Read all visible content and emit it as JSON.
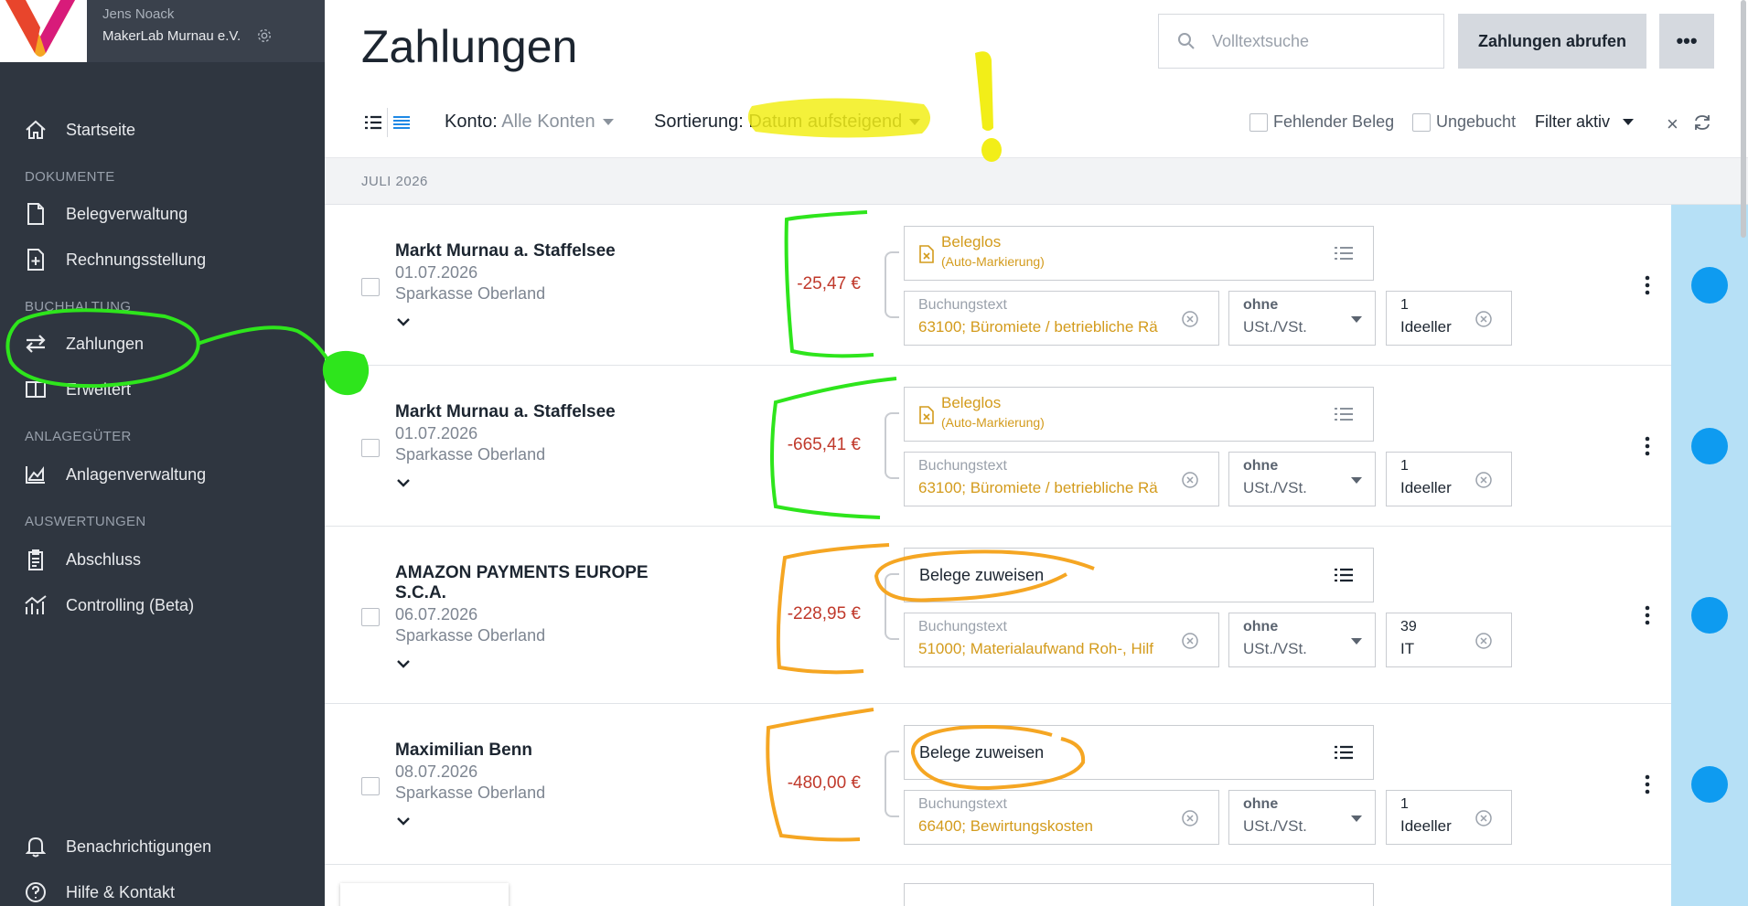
{
  "account": {
    "user": "Jens Noack",
    "org": "MakerLab Murnau e.V."
  },
  "sidebar": {
    "items": [
      {
        "label": "Startseite"
      },
      {
        "section": "DOKUMENTE"
      },
      {
        "label": "Belegverwaltung"
      },
      {
        "label": "Rechnungsstellung"
      },
      {
        "section": "BUCHHALTUNG"
      },
      {
        "label": "Zahlungen"
      },
      {
        "label": "Erweitert"
      },
      {
        "section": "ANLAGEGÜTER"
      },
      {
        "label": "Anlagenverwaltung"
      },
      {
        "section": "AUSWERTUNGEN"
      },
      {
        "label": "Abschluss"
      },
      {
        "label": "Controlling (Beta)"
      }
    ],
    "footer": [
      {
        "label": "Benachrichtigungen"
      },
      {
        "label": "Hilfe & Kontakt"
      }
    ]
  },
  "header": {
    "title": "Zahlungen",
    "search_placeholder": "Volltextsuche",
    "fetch_label": "Zahlungen abrufen",
    "more_label": "•••"
  },
  "toolbar": {
    "account_label": "Konto:",
    "account_value": "Alle Konten",
    "sort_label": "Sortierung:",
    "sort_value": "Datum aufsteigend",
    "missing_receipt": "Fehlender Beleg",
    "unbooked": "Ungebucht",
    "filter": "Filter aktiv",
    "clear": "×"
  },
  "month": "JULI 2026",
  "payments": [
    {
      "payee": "Markt Murnau a. Staffelsee",
      "date": "01.07.2026",
      "bank": "Sparkasse Oberland",
      "amount": "-25,47 €",
      "doc_title": "Beleglos",
      "doc_sub": "(Auto-Markierung)",
      "text_label": "Buchungstext",
      "text_value": "63100; Büromiete / betriebliche Rä",
      "tax_label": "ohne",
      "tax_value": "USt./VSt.",
      "cost_label": "1",
      "cost_value": "Ideeller"
    },
    {
      "payee": "Markt Murnau a. Staffelsee",
      "date": "01.07.2026",
      "bank": "Sparkasse Oberland",
      "amount": "-665,41 €",
      "doc_title": "Beleglos",
      "doc_sub": "(Auto-Markierung)",
      "text_label": "Buchungstext",
      "text_value": "63100; Büromiete / betriebliche Rä",
      "tax_label": "ohne",
      "tax_value": "USt./VSt.",
      "cost_label": "1",
      "cost_value": "Ideeller"
    },
    {
      "payee": "AMAZON PAYMENTS EUROPE S.C.A.",
      "date": "06.07.2026",
      "bank": "Sparkasse Oberland",
      "amount": "-228,95 €",
      "doc_title": "Belege zuweisen",
      "text_label": "Buchungstext",
      "text_value": "51000; Materialaufwand Roh-, Hilf",
      "tax_label": "ohne",
      "tax_value": "USt./VSt.",
      "cost_label": "39",
      "cost_value": "IT"
    },
    {
      "payee": "Maximilian Benn",
      "date": "08.07.2026",
      "bank": "Sparkasse Oberland",
      "amount": "-480,00 €",
      "doc_title": "Belege zuweisen",
      "text_label": "Buchungstext",
      "text_value": "66400; Bewirtungskosten",
      "tax_label": "ohne",
      "tax_value": "USt./VSt.",
      "cost_label": "1",
      "cost_value": "Ideeller"
    }
  ],
  "colors": {
    "sidebar": "#2f3640",
    "amount_negative": "#c0392b",
    "doc_accent": "#d39b1c",
    "status_blue": "#0e9bf0",
    "annotation_green": "#2ee51c",
    "annotation_yellow": "#f2ee18",
    "annotation_orange": "#f5a623"
  }
}
